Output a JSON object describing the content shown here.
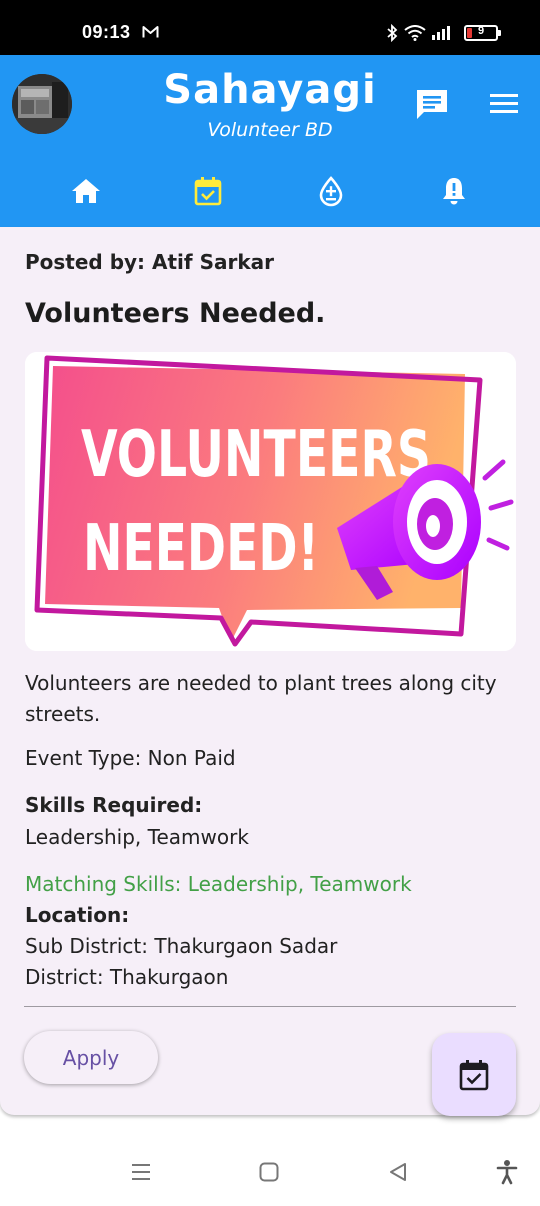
{
  "status_bar": {
    "time": "09:13",
    "battery_level": "9",
    "icons": [
      "gmail-icon",
      "bluetooth-icon",
      "wifi-icon",
      "signal-icon",
      "battery-icon"
    ]
  },
  "header": {
    "title": "Sahayagi",
    "subtitle": "Volunteer BD",
    "actions": [
      "chat-icon",
      "menu-icon"
    ],
    "nav_tabs": [
      {
        "icon": "home-icon",
        "active": false
      },
      {
        "icon": "calendar-check-icon",
        "active": true
      },
      {
        "icon": "blood-drop-icon",
        "active": false
      },
      {
        "icon": "alert-bell-icon",
        "active": false
      }
    ],
    "colors": {
      "bar": "#2196F3",
      "active_tab": "#FFEB3B",
      "icon": "#FFFFFF"
    }
  },
  "post": {
    "posted_by": "Posted by: Atif Sarkar",
    "title": "Volunteers Needed.",
    "image_text_line1": "VOLUNTEERS",
    "image_text_line2": "NEEDED!",
    "description": "Volunteers are needed to plant trees along city streets.",
    "event_type": "Event Type: Non Paid",
    "skills_label": "Skills Required:",
    "skills_value": "Leadership, Teamwork",
    "matching_skills": "Matching Skills: Leadership, Teamwork",
    "location_label": "Location:",
    "sub_district": "Sub District: Thakurgaon Sadar",
    "district": "District: Thakurgaon",
    "apply_label": "Apply",
    "colors": {
      "card": "#F6EFF8",
      "matching": "#43A047",
      "apply_text": "#6750A4",
      "fab": "#EADDFF"
    }
  },
  "system_nav": [
    "recents-icon",
    "home-square-icon",
    "back-triangle-icon",
    "accessibility-icon"
  ]
}
